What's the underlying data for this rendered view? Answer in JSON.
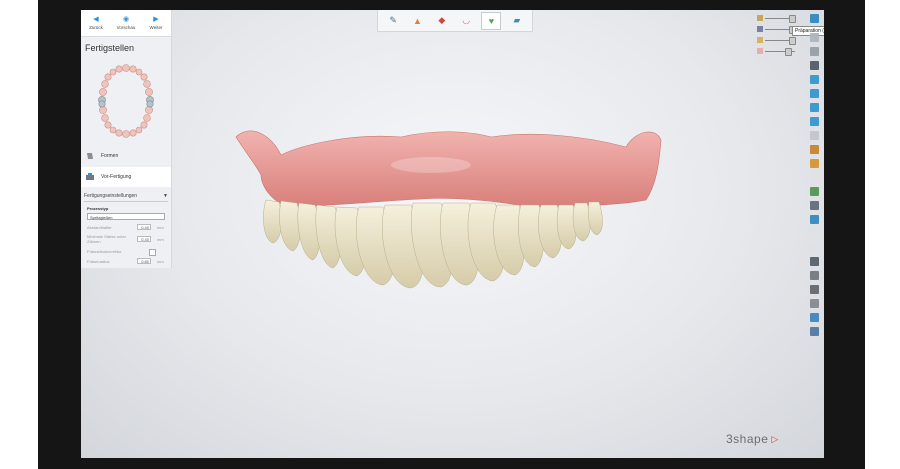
{
  "nav": {
    "back": "Zurück",
    "preview": "Vorschau",
    "next": "Weiter"
  },
  "panel": {
    "title": "Fertigstellen",
    "steps": [
      "Formen",
      "Vor-Fertigung"
    ],
    "settings_title": "Fertigungseinstellungen",
    "process_label": "Prozesstyp",
    "process_value": "Spritzgießen",
    "fields": [
      {
        "label": "Abstandhalter",
        "value": "0.40",
        "unit": "mm"
      },
      {
        "label": "Minimale Stärke unter Zähnen",
        "value": "0.40",
        "unit": "mm"
      },
      {
        "label": "Fräsradiuskorrektur",
        "value": "",
        "unit": ""
      },
      {
        "label": "Fräserradius",
        "value": "0.80",
        "unit": "mm"
      }
    ]
  },
  "tooltip": "Präparation (S)",
  "brand": "3shape",
  "colors": {
    "accent": "#2d8fd5",
    "gum": "#e79a98",
    "tooth": "#ece6cf",
    "logo_mark": "#d43b2f"
  },
  "icons": [
    "back-arrow-icon",
    "eye-icon",
    "forward-arrow-icon",
    "close-icon"
  ]
}
